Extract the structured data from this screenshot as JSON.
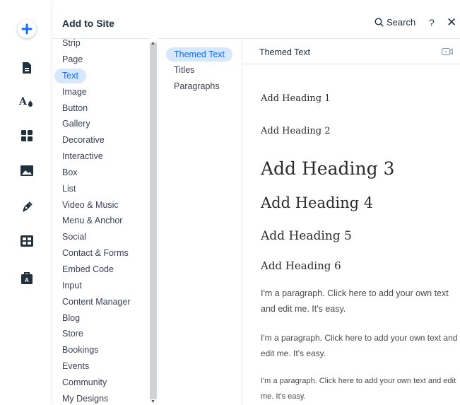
{
  "panel": {
    "title": "Add to Site",
    "search_label": "Search",
    "help_label": "?",
    "close_label": "✕"
  },
  "rail": {
    "items": [
      {
        "name": "add-elements",
        "icon": "plus-icon",
        "color": "#116dff"
      },
      {
        "name": "pages",
        "icon": "page-icon"
      },
      {
        "name": "site-design",
        "icon": "theme-icon"
      },
      {
        "name": "app-market",
        "icon": "apps-grid-icon"
      },
      {
        "name": "media",
        "icon": "image-icon"
      },
      {
        "name": "blog",
        "icon": "pen-nib-icon"
      },
      {
        "name": "cms",
        "icon": "table-icon"
      },
      {
        "name": "portfolio",
        "icon": "briefcase-icon"
      }
    ]
  },
  "categories": [
    "Strip",
    "Page",
    "Text",
    "Image",
    "Button",
    "Gallery",
    "Decorative",
    "Interactive",
    "Box",
    "List",
    "Video & Music",
    "Menu & Anchor",
    "Social",
    "Contact & Forms",
    "Embed Code",
    "Input",
    "Content Manager",
    "Blog",
    "Store",
    "Bookings",
    "Events",
    "Community",
    "My Designs"
  ],
  "active_category": "Text",
  "subcategories": [
    "Themed Text",
    "Titles",
    "Paragraphs"
  ],
  "active_subcategory": "Themed Text",
  "section": {
    "title": "Themed Text",
    "headings": [
      "Add Heading 1",
      "Add Heading 2",
      "Add Heading 3",
      "Add Heading 4",
      "Add Heading 5",
      "Add Heading 6"
    ],
    "paragraphs": [
      "I'm a paragraph. Click here to add your own text and edit me. It's easy.",
      "I'm a paragraph. Click here to add your own text and edit me. It's easy.",
      "I'm a paragraph. Click here to add your own text and edit me. It's easy."
    ]
  },
  "colors": {
    "accent": "#116dff",
    "active_bg": "#d7e7fd",
    "text": "#20303c"
  }
}
